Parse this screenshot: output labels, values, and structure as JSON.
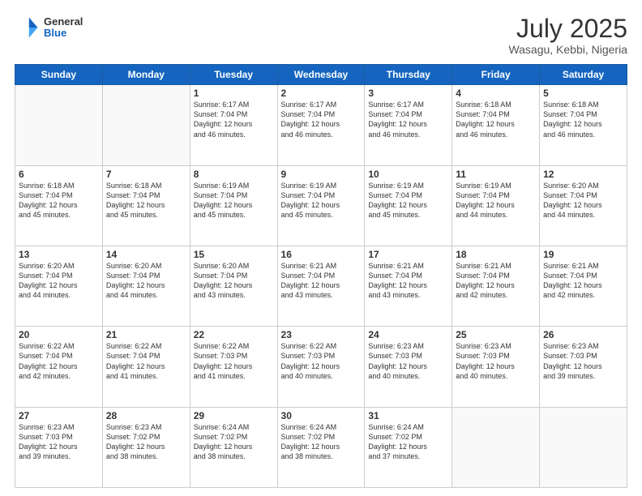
{
  "logo": {
    "general": "General",
    "blue": "Blue"
  },
  "header": {
    "month_year": "July 2025",
    "location": "Wasagu, Kebbi, Nigeria"
  },
  "days_of_week": [
    "Sunday",
    "Monday",
    "Tuesday",
    "Wednesday",
    "Thursday",
    "Friday",
    "Saturday"
  ],
  "weeks": [
    [
      {
        "day": "",
        "info": ""
      },
      {
        "day": "",
        "info": ""
      },
      {
        "day": "1",
        "info": "Sunrise: 6:17 AM\nSunset: 7:04 PM\nDaylight: 12 hours\nand 46 minutes."
      },
      {
        "day": "2",
        "info": "Sunrise: 6:17 AM\nSunset: 7:04 PM\nDaylight: 12 hours\nand 46 minutes."
      },
      {
        "day": "3",
        "info": "Sunrise: 6:17 AM\nSunset: 7:04 PM\nDaylight: 12 hours\nand 46 minutes."
      },
      {
        "day": "4",
        "info": "Sunrise: 6:18 AM\nSunset: 7:04 PM\nDaylight: 12 hours\nand 46 minutes."
      },
      {
        "day": "5",
        "info": "Sunrise: 6:18 AM\nSunset: 7:04 PM\nDaylight: 12 hours\nand 46 minutes."
      }
    ],
    [
      {
        "day": "6",
        "info": "Sunrise: 6:18 AM\nSunset: 7:04 PM\nDaylight: 12 hours\nand 45 minutes."
      },
      {
        "day": "7",
        "info": "Sunrise: 6:18 AM\nSunset: 7:04 PM\nDaylight: 12 hours\nand 45 minutes."
      },
      {
        "day": "8",
        "info": "Sunrise: 6:19 AM\nSunset: 7:04 PM\nDaylight: 12 hours\nand 45 minutes."
      },
      {
        "day": "9",
        "info": "Sunrise: 6:19 AM\nSunset: 7:04 PM\nDaylight: 12 hours\nand 45 minutes."
      },
      {
        "day": "10",
        "info": "Sunrise: 6:19 AM\nSunset: 7:04 PM\nDaylight: 12 hours\nand 45 minutes."
      },
      {
        "day": "11",
        "info": "Sunrise: 6:19 AM\nSunset: 7:04 PM\nDaylight: 12 hours\nand 44 minutes."
      },
      {
        "day": "12",
        "info": "Sunrise: 6:20 AM\nSunset: 7:04 PM\nDaylight: 12 hours\nand 44 minutes."
      }
    ],
    [
      {
        "day": "13",
        "info": "Sunrise: 6:20 AM\nSunset: 7:04 PM\nDaylight: 12 hours\nand 44 minutes."
      },
      {
        "day": "14",
        "info": "Sunrise: 6:20 AM\nSunset: 7:04 PM\nDaylight: 12 hours\nand 44 minutes."
      },
      {
        "day": "15",
        "info": "Sunrise: 6:20 AM\nSunset: 7:04 PM\nDaylight: 12 hours\nand 43 minutes."
      },
      {
        "day": "16",
        "info": "Sunrise: 6:21 AM\nSunset: 7:04 PM\nDaylight: 12 hours\nand 43 minutes."
      },
      {
        "day": "17",
        "info": "Sunrise: 6:21 AM\nSunset: 7:04 PM\nDaylight: 12 hours\nand 43 minutes."
      },
      {
        "day": "18",
        "info": "Sunrise: 6:21 AM\nSunset: 7:04 PM\nDaylight: 12 hours\nand 42 minutes."
      },
      {
        "day": "19",
        "info": "Sunrise: 6:21 AM\nSunset: 7:04 PM\nDaylight: 12 hours\nand 42 minutes."
      }
    ],
    [
      {
        "day": "20",
        "info": "Sunrise: 6:22 AM\nSunset: 7:04 PM\nDaylight: 12 hours\nand 42 minutes."
      },
      {
        "day": "21",
        "info": "Sunrise: 6:22 AM\nSunset: 7:04 PM\nDaylight: 12 hours\nand 41 minutes."
      },
      {
        "day": "22",
        "info": "Sunrise: 6:22 AM\nSunset: 7:03 PM\nDaylight: 12 hours\nand 41 minutes."
      },
      {
        "day": "23",
        "info": "Sunrise: 6:22 AM\nSunset: 7:03 PM\nDaylight: 12 hours\nand 40 minutes."
      },
      {
        "day": "24",
        "info": "Sunrise: 6:23 AM\nSunset: 7:03 PM\nDaylight: 12 hours\nand 40 minutes."
      },
      {
        "day": "25",
        "info": "Sunrise: 6:23 AM\nSunset: 7:03 PM\nDaylight: 12 hours\nand 40 minutes."
      },
      {
        "day": "26",
        "info": "Sunrise: 6:23 AM\nSunset: 7:03 PM\nDaylight: 12 hours\nand 39 minutes."
      }
    ],
    [
      {
        "day": "27",
        "info": "Sunrise: 6:23 AM\nSunset: 7:03 PM\nDaylight: 12 hours\nand 39 minutes."
      },
      {
        "day": "28",
        "info": "Sunrise: 6:23 AM\nSunset: 7:02 PM\nDaylight: 12 hours\nand 38 minutes."
      },
      {
        "day": "29",
        "info": "Sunrise: 6:24 AM\nSunset: 7:02 PM\nDaylight: 12 hours\nand 38 minutes."
      },
      {
        "day": "30",
        "info": "Sunrise: 6:24 AM\nSunset: 7:02 PM\nDaylight: 12 hours\nand 38 minutes."
      },
      {
        "day": "31",
        "info": "Sunrise: 6:24 AM\nSunset: 7:02 PM\nDaylight: 12 hours\nand 37 minutes."
      },
      {
        "day": "",
        "info": ""
      },
      {
        "day": "",
        "info": ""
      }
    ]
  ]
}
